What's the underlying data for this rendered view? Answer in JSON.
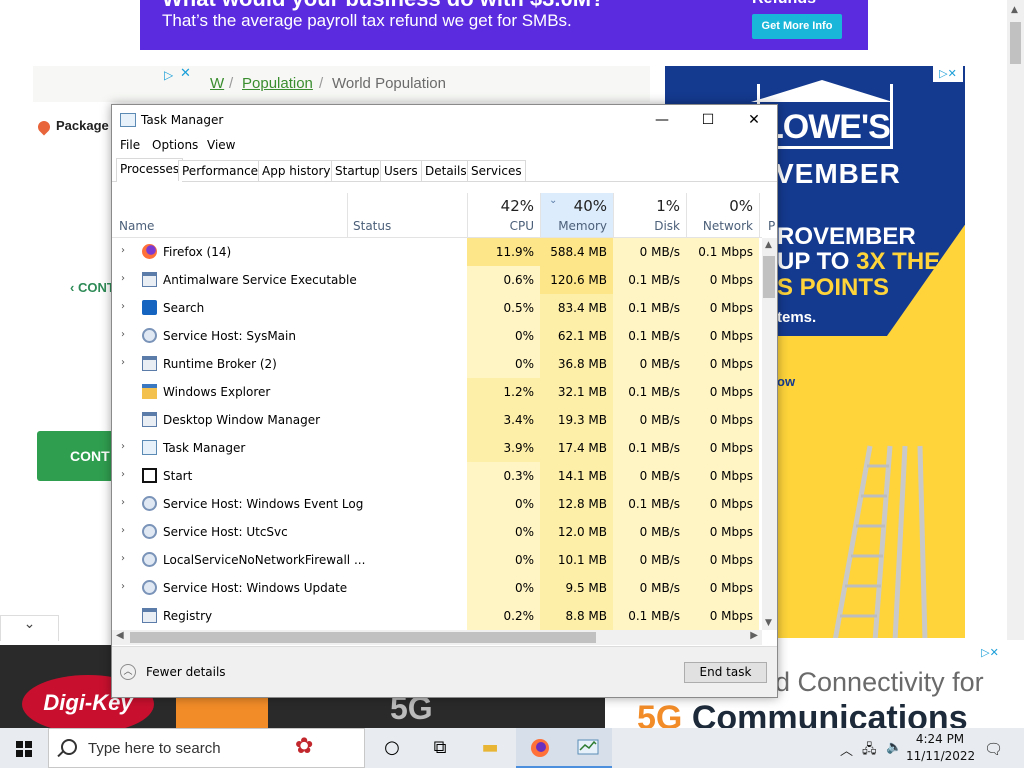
{
  "page": {
    "banner": {
      "headline": "What would your business do with $3.0M?",
      "subtext": "That’s the average payroll tax refund we get for SMBs.",
      "refunds_label": "Refunds",
      "cta_label": "Get More Info"
    },
    "breadcrumb": {
      "home": "W",
      "link": "Population",
      "current": "World Population",
      "sep": "/"
    },
    "package_label": "Package",
    "cont_link": "‹ CONT",
    "cont_button": "CONT",
    "lowes_ad": {
      "logo": "LOWE'S",
      "line0": "VEMBER",
      "line1": "ROVEMBER",
      "line2a": "UP TO ",
      "line2b": "3X THE",
      "line3": "S POINTS",
      "line4": "tems.",
      "shop": "ow"
    },
    "digikey_ad": {
      "logo": "Digi-Key",
      "g5": "5G"
    },
    "conn_ad": {
      "line1": "d Connectivity for",
      "line2a": "5G ",
      "line2b": "Communications"
    }
  },
  "task_manager": {
    "title": "Task Manager",
    "menu": [
      "File",
      "Options",
      "View"
    ],
    "tabs": [
      "Processes",
      "Performance",
      "App history",
      "Startup",
      "Users",
      "Details",
      "Services"
    ],
    "active_tab": "Processes",
    "columns": {
      "name": "Name",
      "status": "Status",
      "cpu": {
        "pct": "42%",
        "label": "CPU"
      },
      "memory": {
        "pct": "40%",
        "label": "Memory"
      },
      "disk": {
        "pct": "1%",
        "label": "Disk"
      },
      "network": {
        "pct": "0%",
        "label": "Network"
      },
      "extra": "P"
    },
    "processes": [
      {
        "name": "Firefox (14)",
        "expand": true,
        "icon": "firefox-icon",
        "cpu": "11.9%",
        "memory": "588.4 MB",
        "disk": "0 MB/s",
        "network": "0.1 Mbps"
      },
      {
        "name": "Antimalware Service Executable",
        "expand": true,
        "icon": "window-icon",
        "cpu": "0.6%",
        "memory": "120.6 MB",
        "disk": "0.1 MB/s",
        "network": "0 Mbps"
      },
      {
        "name": "Search",
        "expand": true,
        "icon": "search-icon",
        "cpu": "0.5%",
        "memory": "83.4 MB",
        "disk": "0.1 MB/s",
        "network": "0 Mbps"
      },
      {
        "name": "Service Host: SysMain",
        "expand": true,
        "icon": "gear-icon",
        "cpu": "0%",
        "memory": "62.1 MB",
        "disk": "0.1 MB/s",
        "network": "0 Mbps"
      },
      {
        "name": "Runtime Broker (2)",
        "expand": true,
        "icon": "window-icon",
        "cpu": "0%",
        "memory": "36.8 MB",
        "disk": "0 MB/s",
        "network": "0 Mbps"
      },
      {
        "name": "Windows Explorer",
        "expand": false,
        "icon": "folder-icon",
        "cpu": "1.2%",
        "memory": "32.1 MB",
        "disk": "0.1 MB/s",
        "network": "0 Mbps"
      },
      {
        "name": "Desktop Window Manager",
        "expand": false,
        "icon": "window-icon",
        "cpu": "3.4%",
        "memory": "19.3 MB",
        "disk": "0 MB/s",
        "network": "0 Mbps"
      },
      {
        "name": "Task Manager",
        "expand": true,
        "icon": "task-manager-icon",
        "cpu": "3.9%",
        "memory": "17.4 MB",
        "disk": "0.1 MB/s",
        "network": "0 Mbps"
      },
      {
        "name": "Start",
        "expand": true,
        "icon": "start-icon",
        "cpu": "0.3%",
        "memory": "14.1 MB",
        "disk": "0 MB/s",
        "network": "0 Mbps"
      },
      {
        "name": "Service Host: Windows Event Log",
        "expand": true,
        "icon": "gear-icon",
        "cpu": "0%",
        "memory": "12.8 MB",
        "disk": "0.1 MB/s",
        "network": "0 Mbps"
      },
      {
        "name": "Service Host: UtcSvc",
        "expand": true,
        "icon": "gear-icon",
        "cpu": "0%",
        "memory": "12.0 MB",
        "disk": "0 MB/s",
        "network": "0 Mbps"
      },
      {
        "name": "LocalServiceNoNetworkFirewall ...",
        "expand": true,
        "icon": "gear-icon",
        "cpu": "0%",
        "memory": "10.1 MB",
        "disk": "0 MB/s",
        "network": "0 Mbps"
      },
      {
        "name": "Service Host: Windows Update",
        "expand": true,
        "icon": "gear-icon",
        "cpu": "0%",
        "memory": "9.5 MB",
        "disk": "0 MB/s",
        "network": "0 Mbps"
      },
      {
        "name": "Registry",
        "expand": false,
        "icon": "window-icon",
        "cpu": "0.2%",
        "memory": "8.8 MB",
        "disk": "0.1 MB/s",
        "network": "0 Mbps"
      }
    ],
    "fewer_details": "Fewer details",
    "end_task": "End task",
    "colors": {
      "heat_high": "#fde68a",
      "heat_mid": "#fdeea8",
      "heat_low": "#fff4c4"
    }
  },
  "taskbar": {
    "search_placeholder": "Type here to search",
    "clock_time": "4:24 PM",
    "clock_date": "11/11/2022",
    "apps": [
      "task-view-icon",
      "file-explorer-icon",
      "firefox-icon",
      "task-manager-icon"
    ]
  }
}
